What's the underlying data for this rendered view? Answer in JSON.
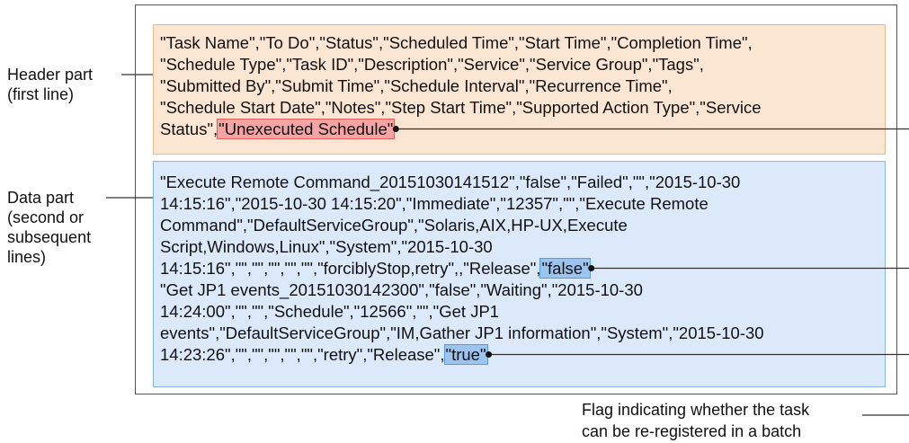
{
  "header_label": [
    "Header part",
    "(first line)"
  ],
  "data_label": [
    "Data part",
    "(second or",
    "subsequent",
    "lines)"
  ],
  "header_lines": [
    "\"Task Name\",\"To Do\",\"Status\",\"Scheduled Time\",\"Start Time\",\"Completion Time\",",
    "\"Schedule Type\",\"Task ID\",\"Description\",\"Service\",\"Service Group\",\"Tags\",",
    "\"Submitted By\",\"Submit Time\",\"Schedule Interval\",\"Recurrence Time\",",
    "\"Schedule Start Date\",\"Notes\",\"Step Start Time\",\"Supported Action Type\",\"Service"
  ],
  "header_last": {
    "prefix": "Status\",",
    "highlight": "\"Unexecuted Schedule\""
  },
  "data_lines_a": [
    "\"Execute Remote Command_20151030141512\",\"false\",\"Failed\",\"\",\"2015-10-30",
    "14:15:16\",\"2015-10-30 14:15:20\",\"Immediate\",\"12357\",\"\",\"Execute Remote",
    "Command\",\"DefaultServiceGroup\",\"Solaris,AIX,HP-UX,Execute",
    "Script,Windows,Linux\",\"System\",\"2015-10-30"
  ],
  "data_line_a_last": {
    "prefix": "14:15:16\",\"\",\"\",\"\",\"\",\"\",\"forciblyStop,retry\",,\"Release\",",
    "highlight": "\"false\""
  },
  "data_lines_b": [
    "\"Get JP1 events_20151030142300\",\"false\",\"Waiting\",\"2015-10-30",
    "14:24:00\",\"\",\"\",\"Schedule\",\"12566\",\"\",\"Get JP1",
    "events\",\"DefaultServiceGroup\",\"IM,Gather JP1 information\",\"System\",\"2015-10-30"
  ],
  "data_line_b_last": {
    "prefix": "14:23:26\",\"\",\"\",\"\",\"\",\"\",\"retry\",\"Release\",",
    "highlight": "\"true\""
  },
  "caption": [
    "Flag indicating whether the task",
    "can be re-registered in a batch"
  ],
  "colors": {
    "header_bg": "#fbe5d3",
    "data_bg": "#dbe9fa",
    "red_highlight": "#f5a3a3",
    "blue_highlight": "#9cc4ee"
  }
}
